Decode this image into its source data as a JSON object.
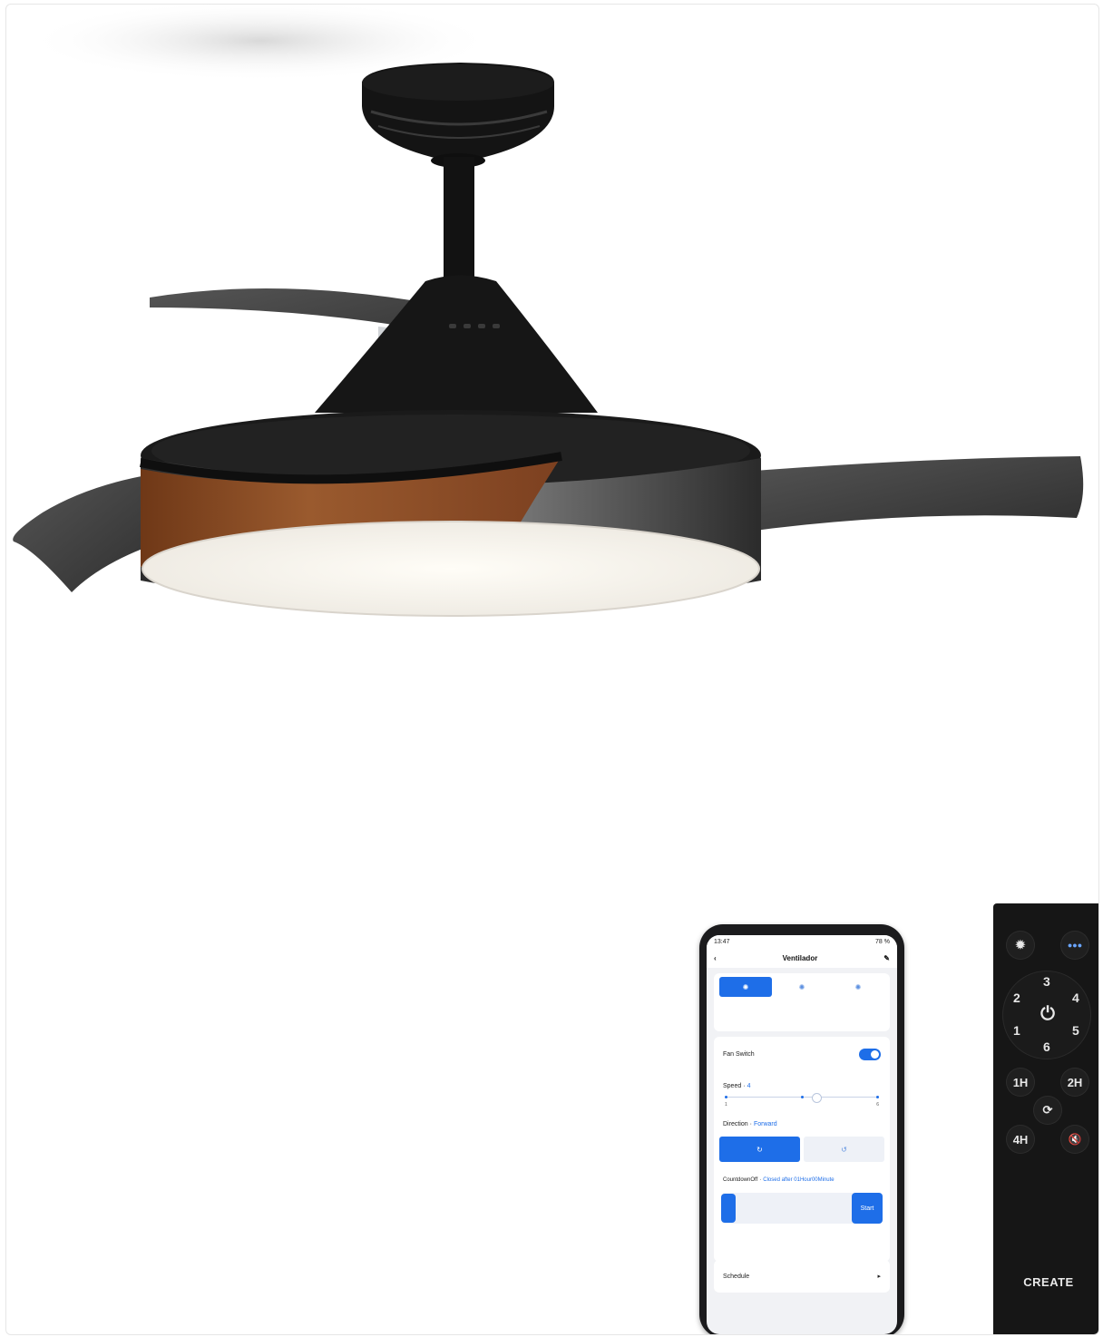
{
  "phone": {
    "status_time": "13:47",
    "status_battery": "78 %",
    "header_title": "Ventilador",
    "fan_switch_label": "Fan Switch",
    "speed_label": "Speed",
    "speed_value": "4",
    "speed_min": "1",
    "speed_max": "6",
    "direction_label": "Direction",
    "direction_value": "Forward",
    "countdown_label": "CountdownOff",
    "countdown_value": "Closed after 01Hour00Minute",
    "start_label": "Start",
    "schedule_label": "Schedule"
  },
  "remote": {
    "buttons": [
      "3",
      "2",
      "4",
      "1",
      "5",
      "6",
      "1H",
      "2H",
      "4H"
    ],
    "brand": "CREATE"
  },
  "colors": {
    "accent": "#1e6ee8",
    "fan_black": "#111111",
    "wood": "#8a4a24",
    "remote_black": "#161616"
  },
  "icons": [
    "back-arrow-icon",
    "edit-icon",
    "sun-icon",
    "rotate-forward-icon",
    "rotate-reverse-icon",
    "chevron-right-icon",
    "bulb-icon",
    "color-dots-icon",
    "power-icon",
    "reverse-icon",
    "mute-icon"
  ]
}
